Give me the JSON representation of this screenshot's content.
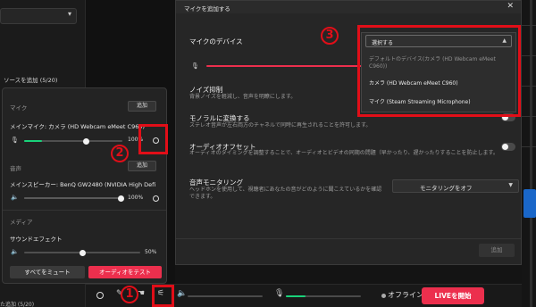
{
  "background": {
    "source_header": "ソースを追加 (5/20)",
    "bottom_left_text": "た追加 (5/20)"
  },
  "bottombar": {
    "offline_label": "オフライン",
    "live_button": "LIVEを開始"
  },
  "audio_popup": {
    "mic_section": "マイク",
    "mic_add": "追加",
    "mic_device": "メインマイク: カメラ (HD Webcam eMeet C960)",
    "mic_percent": "100%",
    "mic_level": 0.85,
    "sound_section": "音声",
    "sound_add": "追加",
    "speaker_device": "メインスピーカー: BenQ GW2480 (NVIDIA High Defi",
    "speaker_percent": "100%",
    "speaker_level": 1.0,
    "media_section": "メディア",
    "effects_label": "サウンドエフェクト",
    "effects_percent": "50%",
    "effects_level": 0.5,
    "mute_all": "すべてをミュート",
    "test_audio": "オーディオをテスト"
  },
  "modal": {
    "title": "マイクを追加する",
    "close": "✕",
    "device_label": "マイクのデバイス",
    "noise_label": "ノイズ抑制",
    "noise_desc": "背景ノイズを軽減し、音声を明瞭にします。",
    "mono_label": "モノラルに変換する",
    "mono_desc": "ステレオ音声が左右両方のチャネルで同時に再生されることを許可します。",
    "offset_label": "オーディオオフセット",
    "offset_desc": "オーディオのタイミングを調整することで、オーディオとビデオの同期の問題（早かったり、遅かったりすることを防止します。",
    "monitor_label": "音声モニタリング",
    "monitor_desc": "ヘッドホンを使用して、視聴者にあなたの音がどのように聞こえているかを確認できます。",
    "monitor_value": "モニタリングをオフ",
    "add_button": "追加"
  },
  "device_dropdown": {
    "placeholder": "選択する",
    "options": [
      {
        "label": "デフォルトのデバイス(カメラ (HD Webcam eMeet C960))",
        "disabled": true
      },
      {
        "label": "カメラ (HD Webcam eMeet C960)",
        "disabled": false
      },
      {
        "label": "マイク (Steam Streaming Microphone)",
        "disabled": false
      }
    ]
  },
  "annotations": {
    "label_1": "1",
    "label_2": "2",
    "label_3": "3"
  },
  "colors": {
    "accent_red": "#ec2f4d",
    "meter_green": "#19d27a",
    "annotation_red": "#e10e18"
  }
}
